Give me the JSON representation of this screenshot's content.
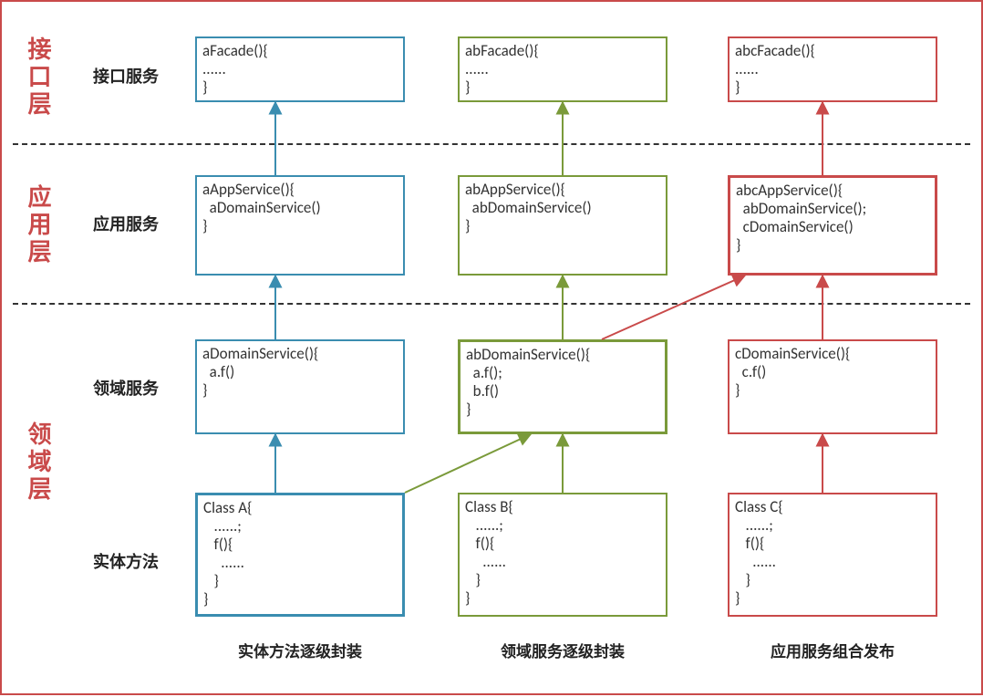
{
  "layers": {
    "interface": "接口层",
    "application": "应用层",
    "domain": "领域层"
  },
  "rows": {
    "facade": "接口服务",
    "app": "应用服务",
    "domain_svc": "领域服务",
    "entity": "实体方法"
  },
  "columns": {
    "a": "实体方法逐级封装",
    "b": "领域服务逐级封装",
    "c": "应用服务组合发布"
  },
  "boxes": {
    "a_facade": "aFacade(){\n......\n}",
    "ab_facade": "abFacade(){\n......\n}",
    "abc_facade": "abcFacade(){\n......\n}",
    "a_app": "aAppService(){\n  aDomainService()\n}",
    "ab_app": "abAppService(){\n  abDomainService()\n}",
    "abc_app": "abcAppService(){\n  abDomainService();\n  cDomainService()\n}",
    "a_domain": "aDomainService(){\n  a.f()\n}",
    "ab_domain": "abDomainService(){\n  a.f();\n  b.f()\n}",
    "c_domain": "cDomainService(){\n  c.f()\n}",
    "class_a": "Class A{\n   ......;\n   f(){\n     ......\n   }\n}",
    "class_b": "Class B{\n   ......;\n   f(){\n     ......\n   }\n}",
    "class_c": "Class C{\n   ......;\n   f(){\n     ......\n   }\n}"
  }
}
